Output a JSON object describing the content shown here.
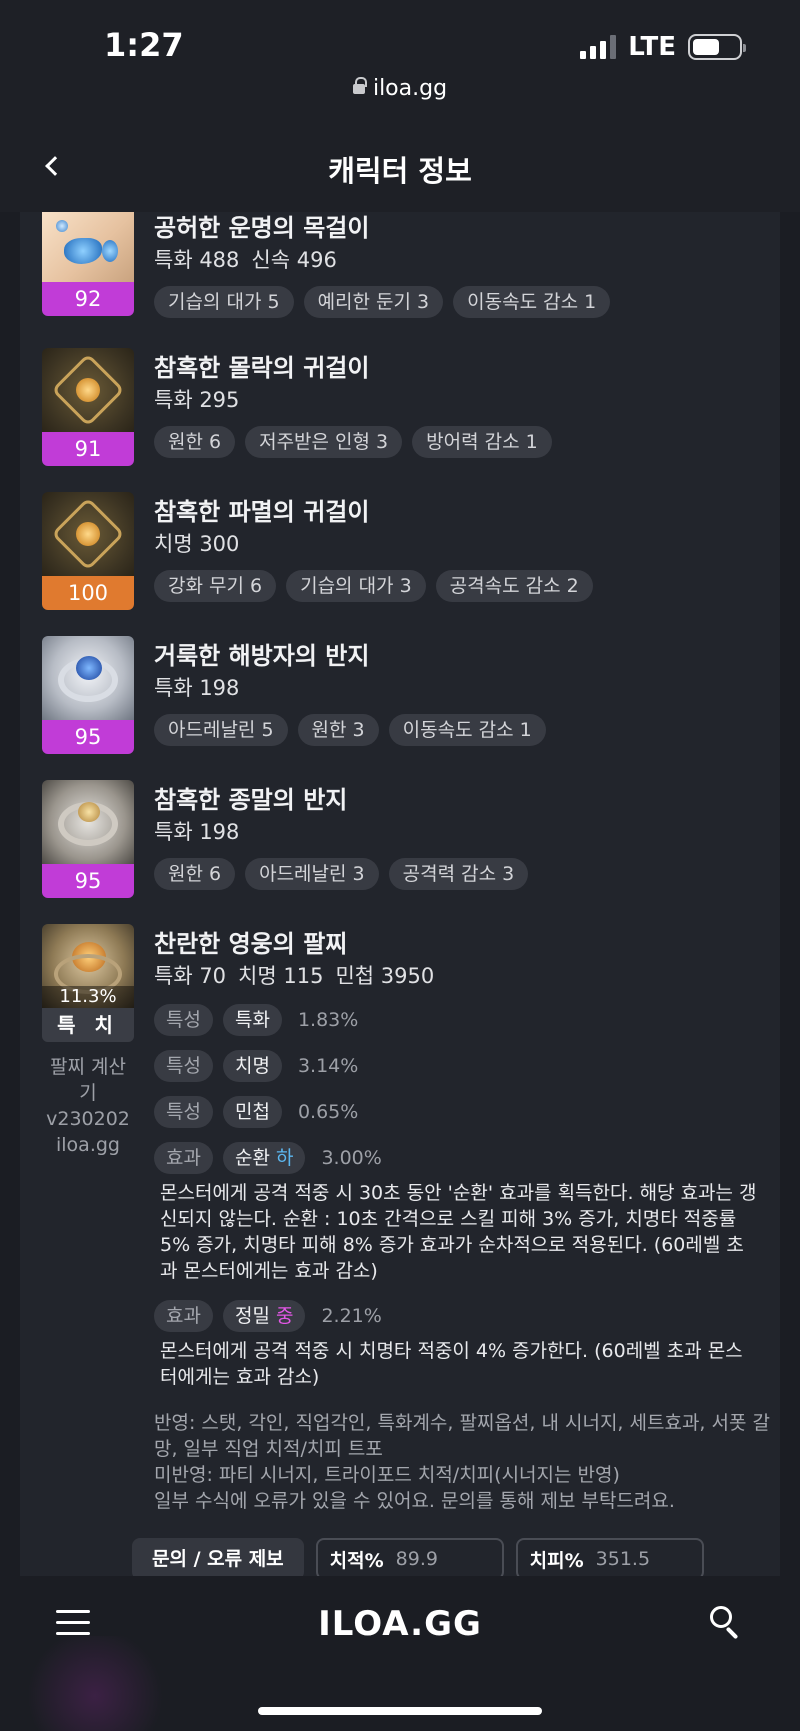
{
  "status": {
    "time": "1:27",
    "network": "LTE"
  },
  "browser": {
    "url": "iloa.gg"
  },
  "header": {
    "title": "캐릭터 정보"
  },
  "items": [
    {
      "name": "공허한 운명의 목걸이",
      "quality": "92",
      "stats": [
        "특화 488",
        "신속 496"
      ],
      "tags": [
        "기습의 대가 5",
        "예리한 둔기 3",
        "이동속도 감소 1"
      ]
    },
    {
      "name": "참혹한 몰락의 귀걸이",
      "quality": "91",
      "stats": [
        "특화 295"
      ],
      "tags": [
        "원한 6",
        "저주받은 인형 3",
        "방어력 감소 1"
      ]
    },
    {
      "name": "참혹한 파멸의 귀걸이",
      "quality": "100",
      "stats": [
        "치명 300"
      ],
      "tags": [
        "강화 무기 6",
        "기습의 대가 3",
        "공격속도 감소 2"
      ]
    },
    {
      "name": "거룩한 해방자의 반지",
      "quality": "95",
      "stats": [
        "특화 198"
      ],
      "tags": [
        "아드레날린 5",
        "원한 3",
        "이동속도 감소 1"
      ]
    },
    {
      "name": "참혹한 종말의 반지",
      "quality": "95",
      "stats": [
        "특화 198"
      ],
      "tags": [
        "원한 6",
        "아드레날린 3",
        "공격력 감소 3"
      ]
    }
  ],
  "bracelet": {
    "name": "찬란한 영웅의 팔찌",
    "percent": "11.3%",
    "foot": "특 치",
    "calc_line1": "팔찌 계산기",
    "calc_line2": "v230202",
    "calc_line3": "iloa.gg",
    "stats": [
      "특화 70",
      "치명 115",
      "민첩 3950"
    ],
    "options": [
      {
        "kind": "특성",
        "name": "특화",
        "grade": "",
        "value": "1.83%"
      },
      {
        "kind": "특성",
        "name": "치명",
        "grade": "",
        "value": "3.14%"
      },
      {
        "kind": "특성",
        "name": "민첩",
        "grade": "",
        "value": "0.65%"
      },
      {
        "kind": "효과",
        "name": "순환",
        "grade": "하",
        "value": "3.00%",
        "desc": "몬스터에게 공격 적중 시 30초 동안 '순환' 효과를 획득한다. 해당 효과는 갱신되지 않는다. 순환 : 10초 간격으로 스킬 피해 3% 증가, 치명타 적중률 5% 증가, 치명타 피해 8% 증가 효과가 순차적으로 적용된다. (60레벨 초과 몬스터에게는 효과 감소)"
      },
      {
        "kind": "효과",
        "name": "정밀",
        "grade": "중",
        "value": "2.21%",
        "desc": "몬스터에게 공격 적중 시 치명타 적중이 4% 증가한다. (60레벨 초과 몬스터에게는 효과 감소)"
      }
    ],
    "note1": "반영: 스탯, 각인, 직업각인, 특화계수, 팔찌옵션, 내 시너지, 세트효과, 서폿 갈망, 일부 직업 치적/치피 트포",
    "note2": "미반영: 파티 시너지, 트라이포드 치적/치피(시너지는 반영)",
    "note3": "일부 수식에 오류가 있을 수 있어요. 문의를 통해 제보 부탁드려요.",
    "report_label": "문의 / 오류 제보",
    "crit_rate_label": "치적%",
    "crit_rate_value": "89.9",
    "crit_dmg_label": "치피%",
    "crit_dmg_value": "351.5"
  },
  "bottom_nav": {
    "logo": "ILOA.GG"
  },
  "colors": {
    "quality_purple": "#c13cd7",
    "quality_orange": "#e07a2f",
    "grade_low": "#5cb7f0",
    "grade_mid": "#e357e6"
  }
}
